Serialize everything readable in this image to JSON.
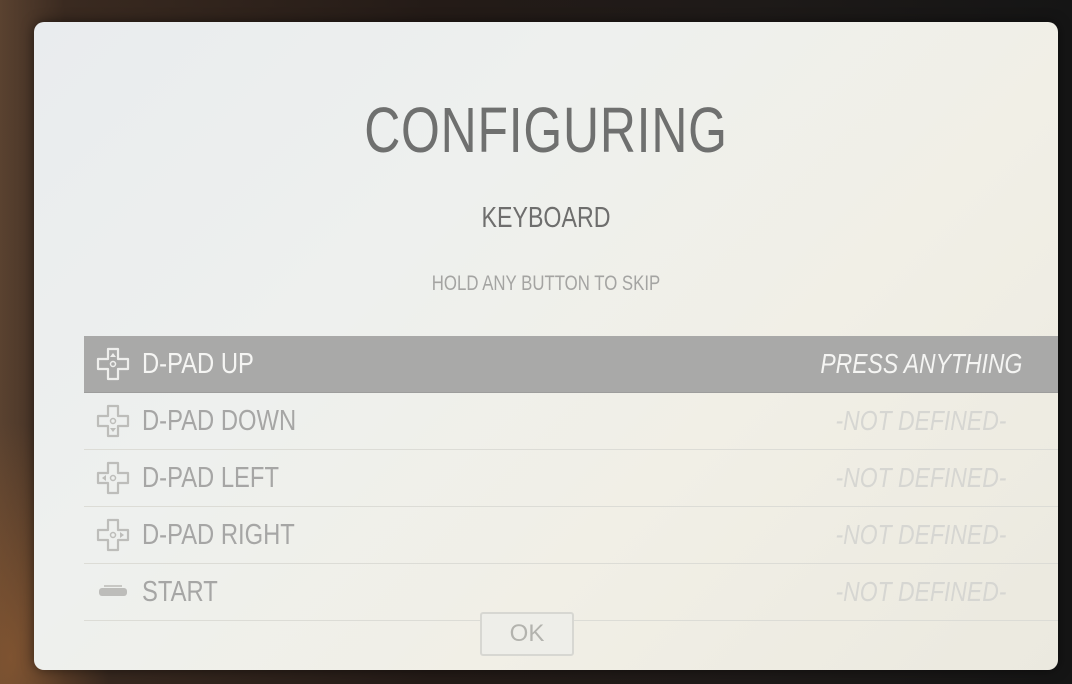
{
  "dialog": {
    "title": "CONFIGURING",
    "subtitle": "KEYBOARD",
    "hint": "HOLD ANY BUTTON TO SKIP",
    "ok_label": "OK"
  },
  "inputs": [
    {
      "icon": "dpad-up-icon",
      "label": "D-PAD UP",
      "status": "PRESS ANYTHING",
      "selected": true
    },
    {
      "icon": "dpad-down-icon",
      "label": "D-PAD DOWN",
      "status": "-NOT DEFINED-",
      "selected": false
    },
    {
      "icon": "dpad-left-icon",
      "label": "D-PAD LEFT",
      "status": "-NOT DEFINED-",
      "selected": false
    },
    {
      "icon": "dpad-right-icon",
      "label": "D-PAD RIGHT",
      "status": "-NOT DEFINED-",
      "selected": false
    },
    {
      "icon": "start-button-icon",
      "label": "START",
      "status": "-NOT DEFINED-",
      "selected": false
    }
  ],
  "colors": {
    "selected_row": "#a9a9a8",
    "dialog_background": "#eef0ee",
    "muted_text": "#a6a6a5"
  }
}
